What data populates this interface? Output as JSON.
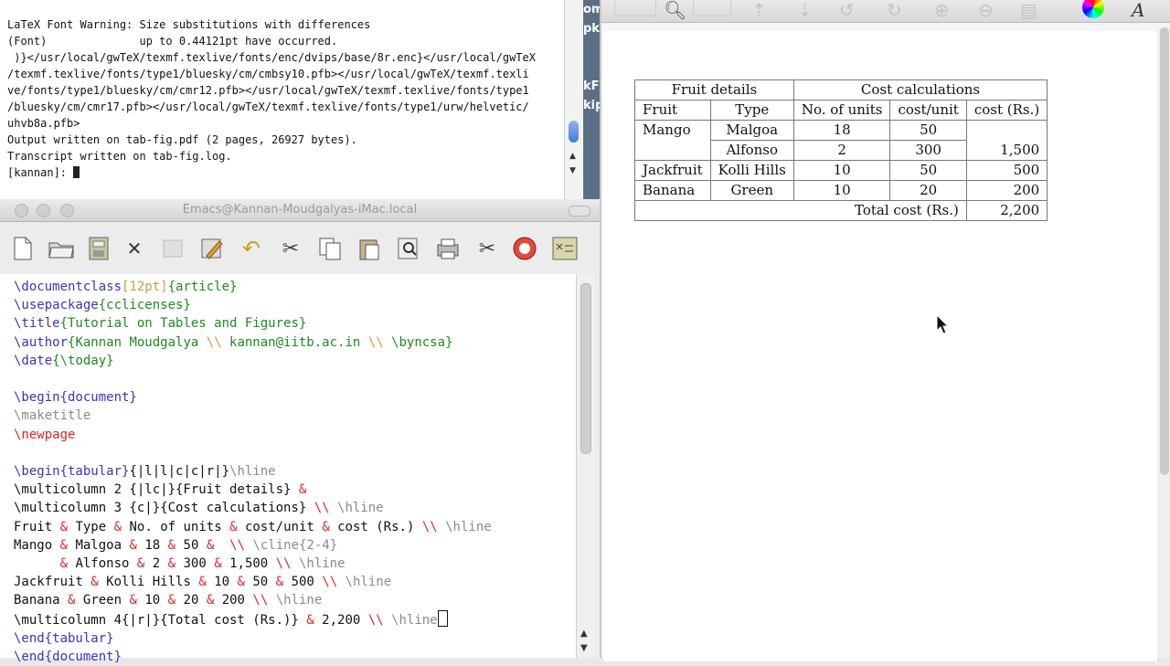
{
  "terminal": {
    "lines": [
      "LaTeX Font Warning: Size substitutions with differences",
      "(Font)              up to 0.44121pt have occurred.",
      "",
      " )}</usr/local/gwTeX/texmf.texlive/fonts/enc/dvips/base/8r.enc}</usr/local/gwTeX",
      "/texmf.texlive/fonts/type1/bluesky/cm/cmbsy10.pfb></usr/local/gwTeX/texmf.texli",
      "ve/fonts/type1/bluesky/cm/cmr12.pfb></usr/local/gwTeX/texmf.texlive/fonts/type1",
      "/bluesky/cm/cmr17.pfb></usr/local/gwTeX/texmf.texlive/fonts/type1/urw/helvetic/",
      "uhvb8a.pfb>",
      "Output written on tab-fig.pdf (2 pages, 26927 bytes).",
      "Transcript written on tab-fig.log."
    ],
    "prompt": "[kannan]: "
  },
  "side_strip": {
    "lines": [
      "om",
      "pk",
      "",
      "",
      "kF",
      "kip"
    ]
  },
  "emacs": {
    "title": "Emacs@Kannan-Moudgalyas-iMac.local",
    "toolbar_icons": [
      "new-file-icon",
      "open-folder-icon",
      "save-icon",
      "close-icon",
      "disabled-icon",
      "write-icon",
      "undo-icon",
      "cut-icon",
      "copy-icon",
      "paste-icon",
      "search-icon",
      "print-icon",
      "tools-icon",
      "help-icon",
      "latex-icon"
    ],
    "code": {
      "l1": {
        "cmd": "\\documentclass",
        "opt": "[12pt]",
        "arg": "{article}"
      },
      "l2": {
        "cmd": "\\usepackage",
        "arg": "{cclicenses}"
      },
      "l3": {
        "cmd": "\\title",
        "arg": "{Tutorial on Tables and Figures}"
      },
      "l4": {
        "cmd": "\\author",
        "arg1": "{Kannan Moudgalya ",
        "sep1": "\\\\",
        "arg2": " kannan@iitb.ac.in ",
        "sep2": "\\\\",
        "tail": " \\byncsa}"
      },
      "l5": {
        "cmd": "\\date",
        "arg": "{\\today}"
      },
      "l6": {
        "cmd": "\\begin",
        "arg": "{document}"
      },
      "l7": {
        "text": "\\maketitle"
      },
      "l8": {
        "text": "\\newpage"
      },
      "l9": {
        "cmd": "\\begin",
        "arg": "{tabular}",
        "rest": "{|l|l|c|c|r|}",
        "hline": "\\hline"
      },
      "l10": {
        "a": "\\multicolumn 2 {|lc|}{Fruit details} ",
        "amp": "&"
      },
      "l11": {
        "a": "\\multicolumn 3 {c|}{Cost calculations} ",
        "br": "\\\\",
        "hline": " \\hline"
      },
      "l12": {
        "a": "Fruit ",
        "b": "Type ",
        "c": "No. of units ",
        "d": "cost/unit ",
        "e": "cost (Rs.) ",
        "br": "\\\\",
        "hline": " \\hline"
      },
      "l13": {
        "a": "Mango ",
        "b": "Malgoa ",
        "c": "18 ",
        "d": "50 ",
        "br": " \\\\",
        "hline": " \\cline{2-4}"
      },
      "l14": {
        "indent": "      ",
        "b": "Alfonso ",
        "c": "2 ",
        "d": "300 ",
        "e": "1,500 ",
        "br": "\\\\",
        "hline": " \\hline"
      },
      "l15": {
        "a": "Jackfruit ",
        "b": "Kolli Hills ",
        "c": "10 ",
        "d": "50 ",
        "e": "500 ",
        "br": "\\\\",
        "hline": " \\hline"
      },
      "l16": {
        "a": "Banana ",
        "b": "Green ",
        "c": "10 ",
        "d": "20 ",
        "e": "200 ",
        "br": "\\\\",
        "hline": " \\hline"
      },
      "l17": {
        "a": "\\multicolumn 4{|r|}{Total cost (Rs.)} ",
        "b": "2,200 ",
        "br": "\\\\",
        "hline": " \\hline"
      },
      "l18": {
        "cmd": "\\end",
        "arg": "{tabular}"
      },
      "l19": {
        "cmd": "\\end",
        "arg": "{document}"
      },
      "amp": "&"
    }
  },
  "viewer": {
    "toolbar_icons": [
      "search-icon",
      "page-up-icon",
      "page-down-icon",
      "rotate-left-icon",
      "rotate-right-icon",
      "zoom-in-icon",
      "zoom-out-icon",
      "print-icon",
      "color-wheel-icon",
      "font-icon"
    ],
    "table": {
      "group_headers": [
        "Fruit details",
        "Cost calculations"
      ],
      "columns": [
        "Fruit",
        "Type",
        "No. of units",
        "cost/unit",
        "cost (Rs.)"
      ],
      "rows": [
        [
          "Mango",
          "Malgoa",
          "18",
          "50",
          ""
        ],
        [
          "",
          "Alfonso",
          "2",
          "300",
          "1,500"
        ],
        [
          "Jackfruit",
          "Kolli Hills",
          "10",
          "50",
          "500"
        ],
        [
          "Banana",
          "Green",
          "10",
          "20",
          "200"
        ]
      ],
      "total_label": "Total cost (Rs.)",
      "total_value": "2,200"
    }
  }
}
